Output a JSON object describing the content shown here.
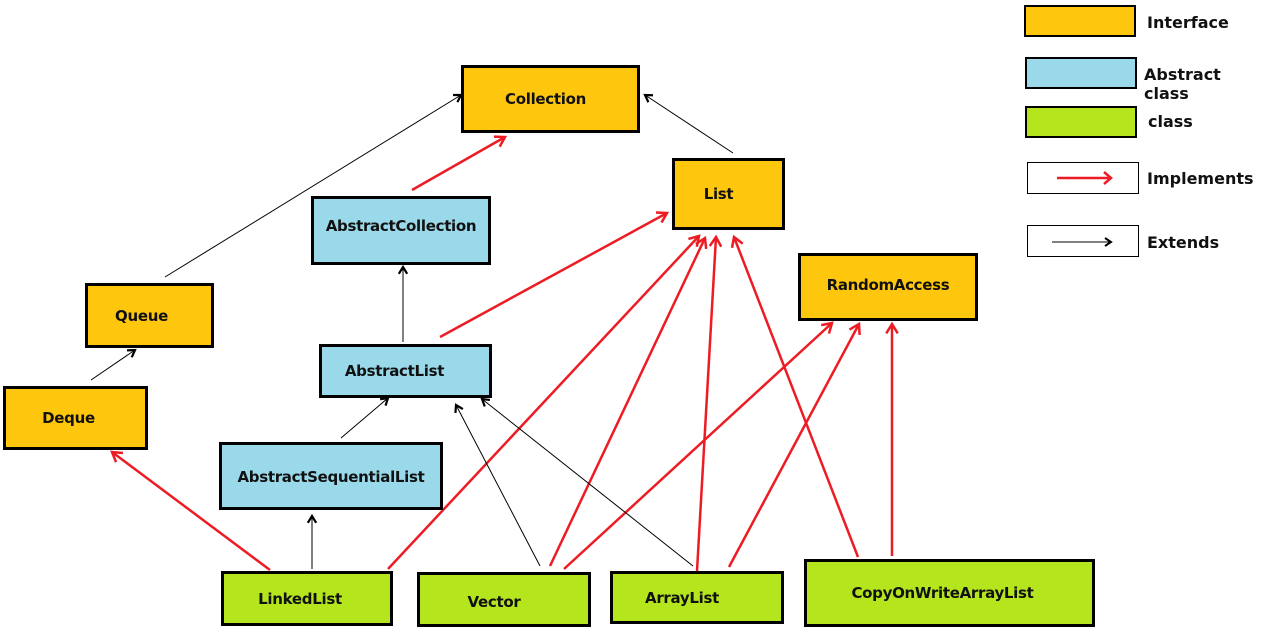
{
  "colors": {
    "interface": "#FEC70E",
    "abstract_class": "#99D9EA",
    "class": "#B5E61D",
    "implements": "#ED1C24",
    "extends": "#000000"
  },
  "legend": {
    "interface": "Interface",
    "abstract_class": "Abstract class",
    "class": "class",
    "implements": "Implements",
    "extends": "Extends"
  },
  "nodes": {
    "collection": {
      "label": "Collection",
      "kind": "interface"
    },
    "list": {
      "label": "List",
      "kind": "interface"
    },
    "queue": {
      "label": "Queue",
      "kind": "interface"
    },
    "deque": {
      "label": "Deque",
      "kind": "interface"
    },
    "random_access": {
      "label": "RandomAccess",
      "kind": "interface"
    },
    "abstract_collection": {
      "label": "AbstractCollection",
      "kind": "abstract_class"
    },
    "abstract_list": {
      "label": "AbstractList",
      "kind": "abstract_class"
    },
    "abstract_sequential_list": {
      "label": "AbstractSequentialList",
      "kind": "abstract_class"
    },
    "linked_list": {
      "label": "LinkedList",
      "kind": "class"
    },
    "vector": {
      "label": "Vector",
      "kind": "class"
    },
    "array_list": {
      "label": "ArrayList",
      "kind": "class"
    },
    "copy_on_write_array_list": {
      "label": "CopyOnWriteArrayList",
      "kind": "class"
    }
  },
  "edges": [
    {
      "from": "queue",
      "to": "collection",
      "type": "extends"
    },
    {
      "from": "list",
      "to": "collection",
      "type": "extends"
    },
    {
      "from": "deque",
      "to": "queue",
      "type": "extends"
    },
    {
      "from": "abstract_collection",
      "to": "collection",
      "type": "implements"
    },
    {
      "from": "abstract_list",
      "to": "abstract_collection",
      "type": "extends"
    },
    {
      "from": "abstract_list",
      "to": "list",
      "type": "implements"
    },
    {
      "from": "abstract_sequential_list",
      "to": "abstract_list",
      "type": "extends"
    },
    {
      "from": "linked_list",
      "to": "abstract_sequential_list",
      "type": "extends"
    },
    {
      "from": "linked_list",
      "to": "deque",
      "type": "implements"
    },
    {
      "from": "linked_list",
      "to": "list",
      "type": "implements"
    },
    {
      "from": "vector",
      "to": "abstract_list",
      "type": "extends"
    },
    {
      "from": "vector",
      "to": "list",
      "type": "implements"
    },
    {
      "from": "vector",
      "to": "random_access",
      "type": "implements"
    },
    {
      "from": "array_list",
      "to": "abstract_list",
      "type": "extends"
    },
    {
      "from": "array_list",
      "to": "list",
      "type": "implements"
    },
    {
      "from": "array_list",
      "to": "random_access",
      "type": "implements"
    },
    {
      "from": "copy_on_write_array_list",
      "to": "list",
      "type": "implements"
    },
    {
      "from": "copy_on_write_array_list",
      "to": "random_access",
      "type": "implements"
    }
  ]
}
